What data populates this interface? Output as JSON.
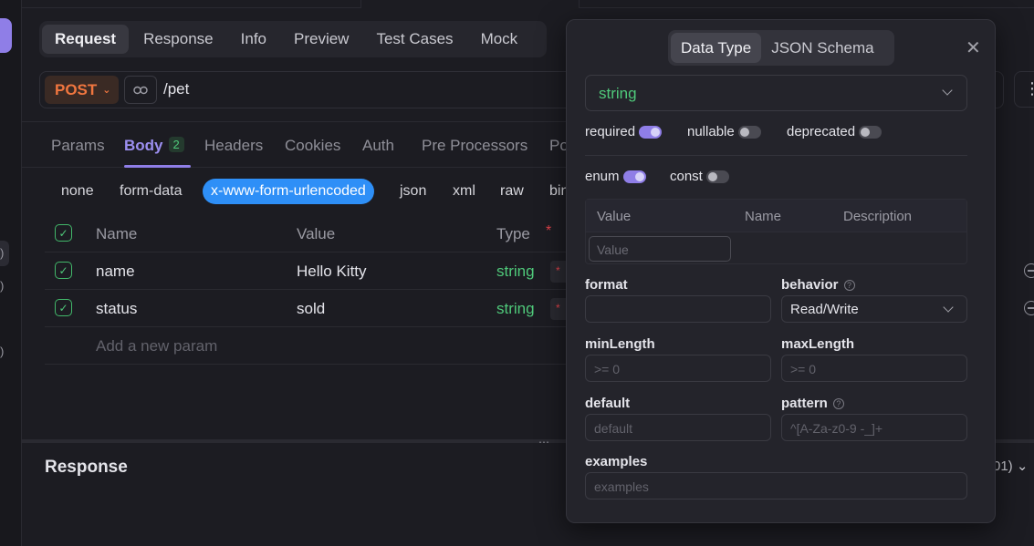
{
  "request_tabs": [
    "Request",
    "Response",
    "Info",
    "Preview",
    "Test Cases",
    "Mock"
  ],
  "request": {
    "method": "POST",
    "path": "/pet"
  },
  "param_tabs": {
    "params": "Params",
    "body": "Body",
    "body_count": "2",
    "headers": "Headers",
    "cookies": "Cookies",
    "auth": "Auth",
    "pre_processors": "Pre Processors",
    "post_fragment": "Po"
  },
  "body_types": [
    "none",
    "form-data",
    "x-www-form-urlencoded",
    "json",
    "xml",
    "raw",
    "bin"
  ],
  "params_table": {
    "headers": {
      "name": "Name",
      "value": "Value",
      "type": "Type"
    },
    "rows": [
      {
        "name": "name",
        "value": "Hello Kitty",
        "type": "string"
      },
      {
        "name": "status",
        "value": "sold",
        "type": "string"
      }
    ],
    "add_placeholder": "Add a new param"
  },
  "response": {
    "title": "Response",
    "status_fragment": "01)"
  },
  "rail_fragments": [
    ")",
    ")",
    ")"
  ],
  "popover": {
    "tabs": {
      "data_type": "Data Type",
      "json_schema": "JSON Schema"
    },
    "type_value": "string",
    "flags": {
      "required": {
        "label": "required",
        "on": true
      },
      "nullable": {
        "label": "nullable",
        "on": false
      },
      "deprecated": {
        "label": "deprecated",
        "on": false
      },
      "enum": {
        "label": "enum",
        "on": true
      },
      "const": {
        "label": "const",
        "on": false
      }
    },
    "enum_table": {
      "value": "Value",
      "name": "Name",
      "description": "Description",
      "input_placeholder": "Value"
    },
    "fields": {
      "format": {
        "label": "format",
        "placeholder": ""
      },
      "behavior": {
        "label": "behavior",
        "value": "Read/Write"
      },
      "min_length": {
        "label": "minLength",
        "placeholder": ">= 0"
      },
      "max_length": {
        "label": "maxLength",
        "placeholder": ">= 0"
      },
      "default": {
        "label": "default",
        "placeholder": "default"
      },
      "pattern": {
        "label": "pattern",
        "placeholder": "^[A-Za-z0-9 -_]+"
      },
      "examples": {
        "label": "examples",
        "placeholder": "examples"
      }
    }
  },
  "colors": {
    "accent": "#8f7ee7",
    "method": "#f0763f",
    "type": "#4fc97a",
    "active_body": "#2e8ff7",
    "required": "#e0424a"
  }
}
